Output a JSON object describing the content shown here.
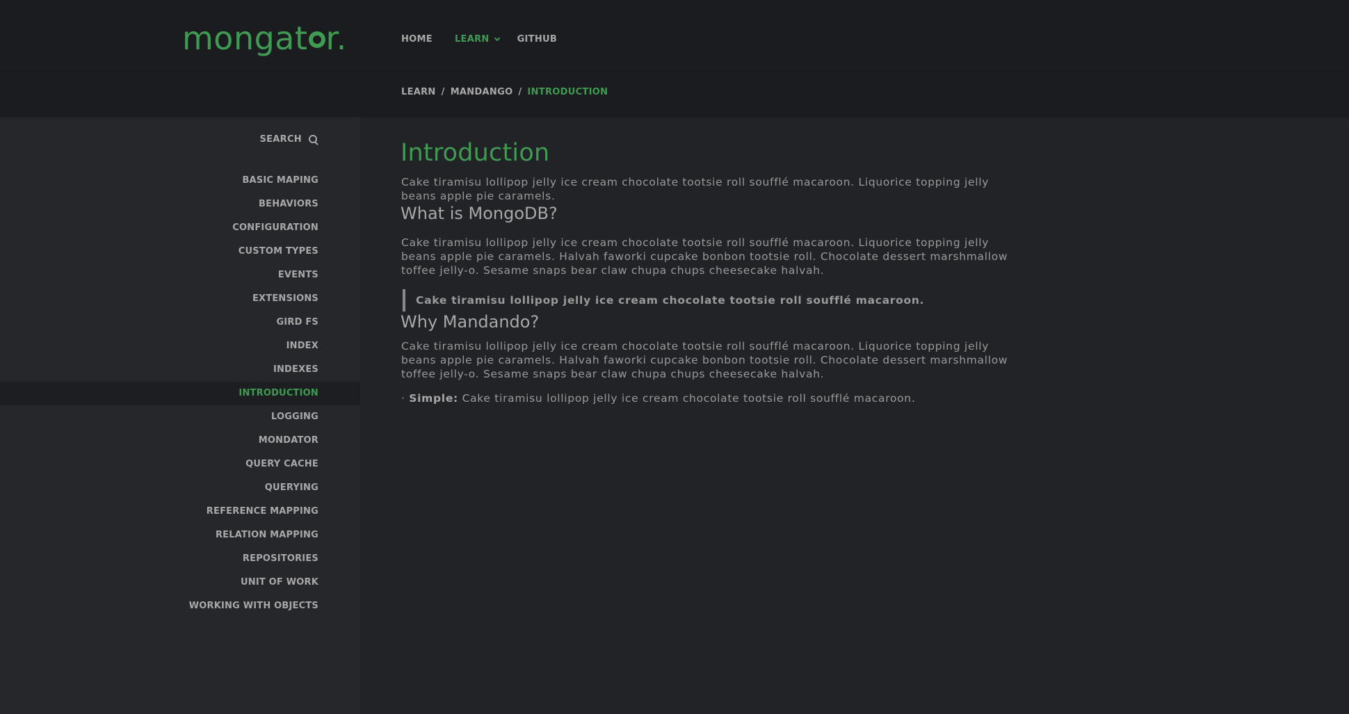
{
  "logo": {
    "text_pre": "mongat",
    "text_post": "r."
  },
  "nav": {
    "home": "HOME",
    "learn": "LEARN",
    "github": "GITHUB"
  },
  "breadcrumb": {
    "items": [
      "LEARN",
      "MANDANGO",
      "INTRODUCTION"
    ],
    "separator": "/"
  },
  "sidebar": {
    "search_label": "SEARCH",
    "items": [
      {
        "label": "BASIC MAPING"
      },
      {
        "label": "BEHAVIORS"
      },
      {
        "label": "CONFIGURATION"
      },
      {
        "label": "CUSTOM TYPES"
      },
      {
        "label": "EVENTS"
      },
      {
        "label": "EXTENSIONS"
      },
      {
        "label": "GIRD FS"
      },
      {
        "label": "INDEX"
      },
      {
        "label": "INDEXES"
      },
      {
        "label": "INTRODUCTION",
        "active": true
      },
      {
        "label": "LOGGING"
      },
      {
        "label": "MONDATOR"
      },
      {
        "label": "QUERY CACHE"
      },
      {
        "label": "QUERYING"
      },
      {
        "label": "REFERENCE MAPPING"
      },
      {
        "label": "RELATION MAPPING"
      },
      {
        "label": "REPOSITORIES"
      },
      {
        "label": "UNIT OF WORK"
      },
      {
        "label": "WORKING WITH OBJECTS"
      }
    ]
  },
  "main": {
    "title": "Introduction",
    "intro": "Cake tiramisu lollipop jelly ice cream chocolate tootsie roll soufflé macaroon. Liquorice topping jelly beans apple pie caramels.",
    "section1": {
      "heading": "What is MongoDB?",
      "body": "Cake tiramisu lollipop jelly ice cream chocolate tootsie roll soufflé macaroon. Liquorice topping jelly beans apple pie caramels. Halvah faworki cupcake bonbon tootsie roll. Chocolate dessert marshmallow toffee je­lly-o. Sesame snaps bear claw chupa chups cheesecake halvah.",
      "quote": "Cake tiramisu lollipop jelly ice cream chocolate tootsie roll soufflé macaroon."
    },
    "section2": {
      "heading": "Why Mandando?",
      "body": "Cake tiramisu lollipop jelly ice cream chocolate tootsie roll soufflé macaroon. Liquorice topping jelly beans apple pie caramels. Halvah faworki cupcake bonbon tootsie roll. Chocolate dessert marshmallow toffee je­lly-o. Sesame snaps bear claw chupa chups cheesecake halvah.",
      "bullet_marker": "·",
      "bullet_label": "Simple:",
      "bullet_text": "Cake tiramisu lollipop jelly ice cream chocolate tootsie roll soufflé macaroon."
    }
  },
  "colors": {
    "accent": "#3f9b52",
    "background": "#222326",
    "header": "#1b1c1f",
    "sidebar": "#26272b",
    "text": "#9a9a9a"
  }
}
